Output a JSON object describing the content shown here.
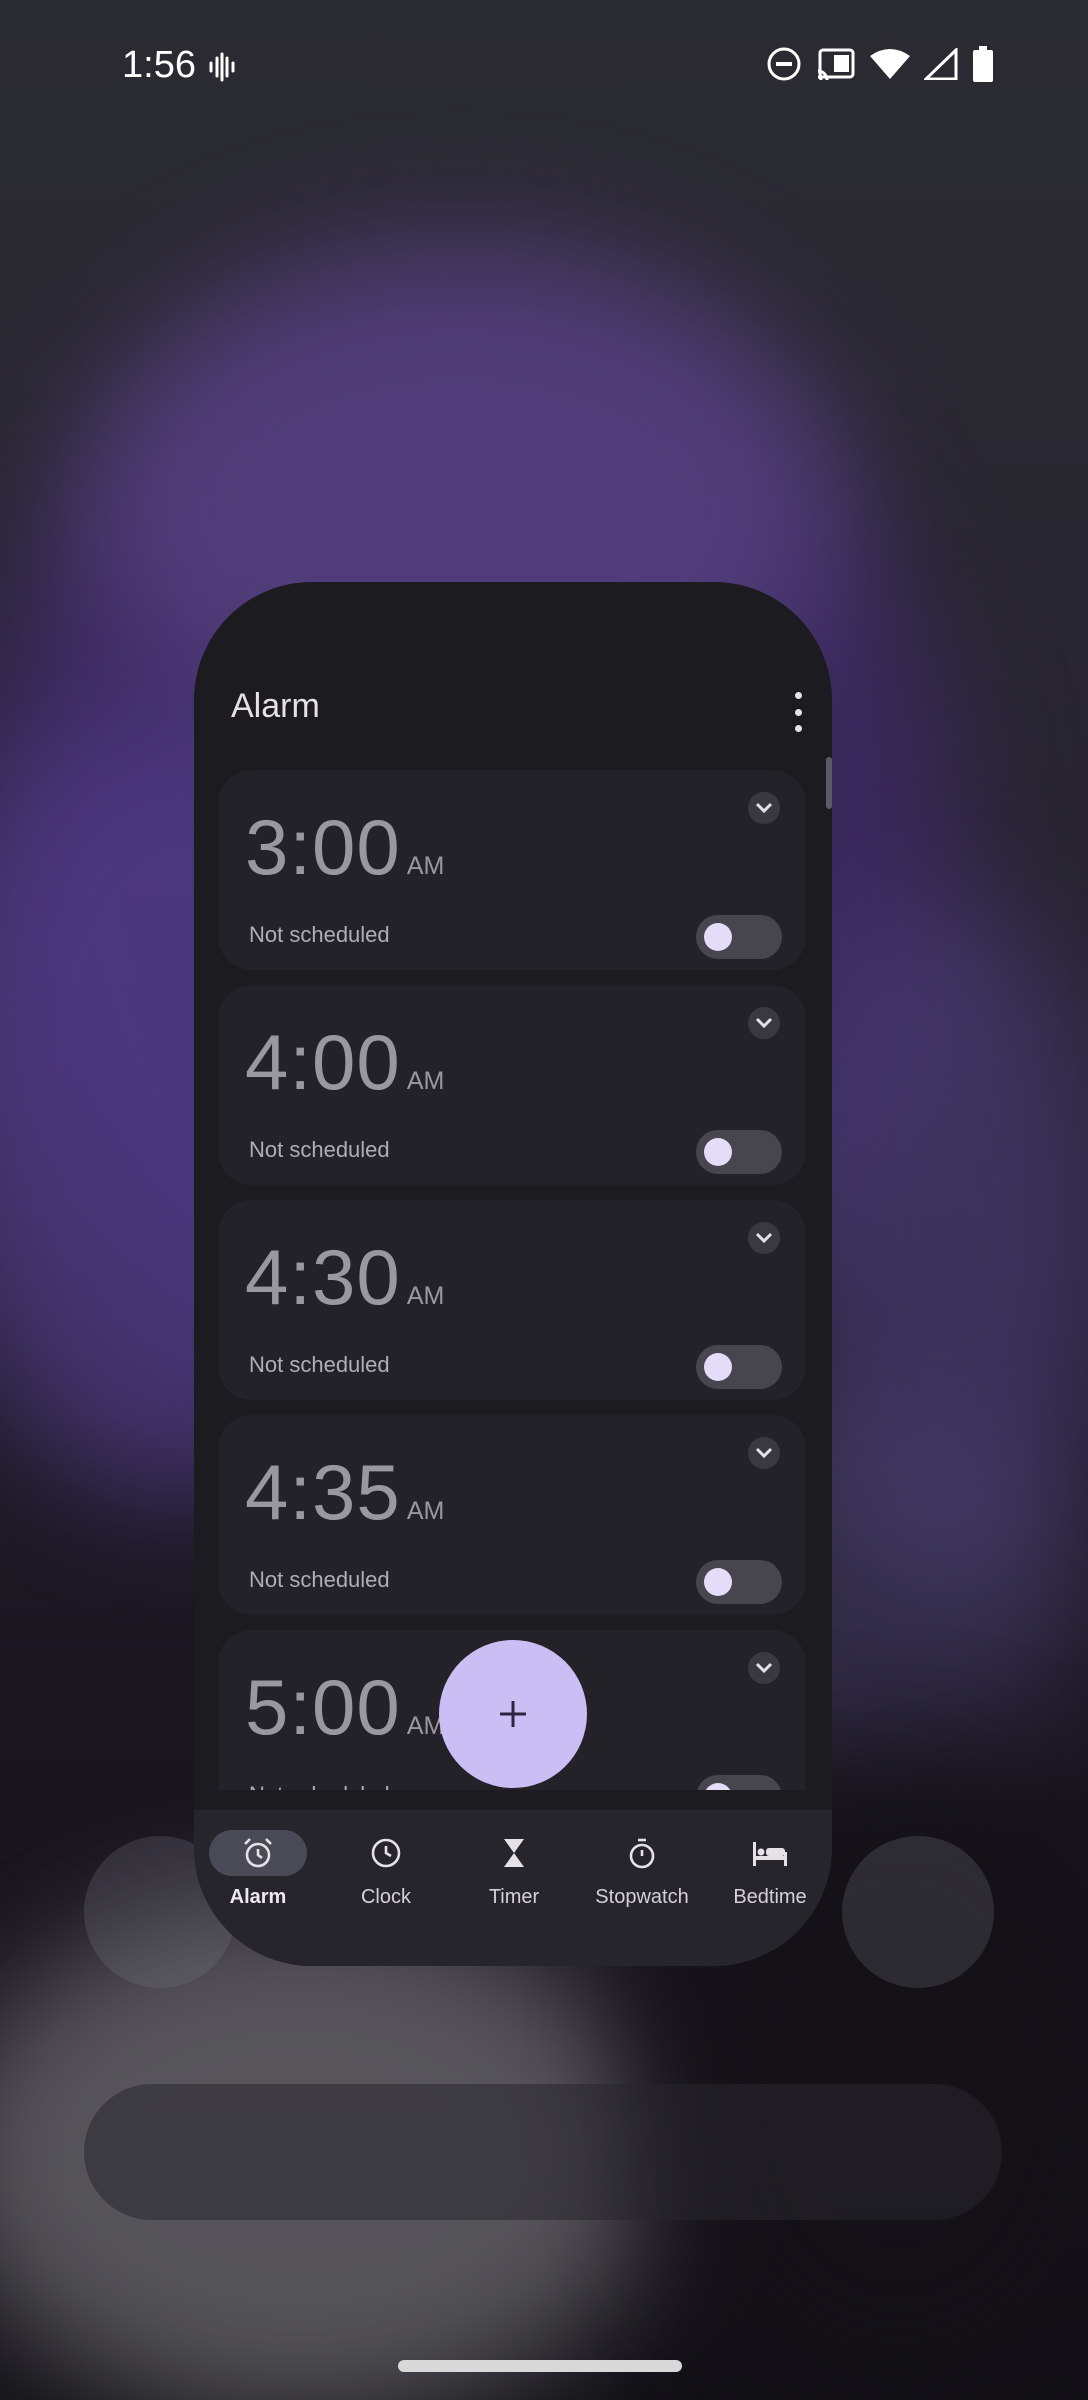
{
  "status_bar": {
    "time": "1:56",
    "icons": [
      "vibrate-icon",
      "do-not-disturb-icon",
      "cast-icon",
      "wifi-icon",
      "signal-icon",
      "battery-icon"
    ]
  },
  "widget": {
    "title": "Alarm",
    "menu_icon": "more-vertical-icon",
    "alarms": [
      {
        "time": "3:00",
        "ampm": "AM",
        "status": "Not scheduled",
        "enabled": false
      },
      {
        "time": "4:00",
        "ampm": "AM",
        "status": "Not scheduled",
        "enabled": false
      },
      {
        "time": "4:30",
        "ampm": "AM",
        "status": "Not scheduled",
        "enabled": false
      },
      {
        "time": "4:35",
        "ampm": "AM",
        "status": "Not scheduled",
        "enabled": false
      },
      {
        "time": "5:00",
        "ampm": "AM",
        "status": "Not scheduled",
        "enabled": false
      }
    ],
    "fab_icon": "plus-icon",
    "fab_label": "+",
    "nav": [
      {
        "label": "Alarm",
        "icon": "alarm-icon",
        "active": true
      },
      {
        "label": "Clock",
        "icon": "clock-icon",
        "active": false
      },
      {
        "label": "Timer",
        "icon": "hourglass-icon",
        "active": false
      },
      {
        "label": "Stopwatch",
        "icon": "stopwatch-icon",
        "active": false
      },
      {
        "label": "Bedtime",
        "icon": "bed-icon",
        "active": false
      }
    ]
  },
  "colors": {
    "widget_bg": "#1c1b20",
    "card_bg": "#232229",
    "fab": "#cbbef5",
    "accent_knob": "#e4dcf8"
  }
}
